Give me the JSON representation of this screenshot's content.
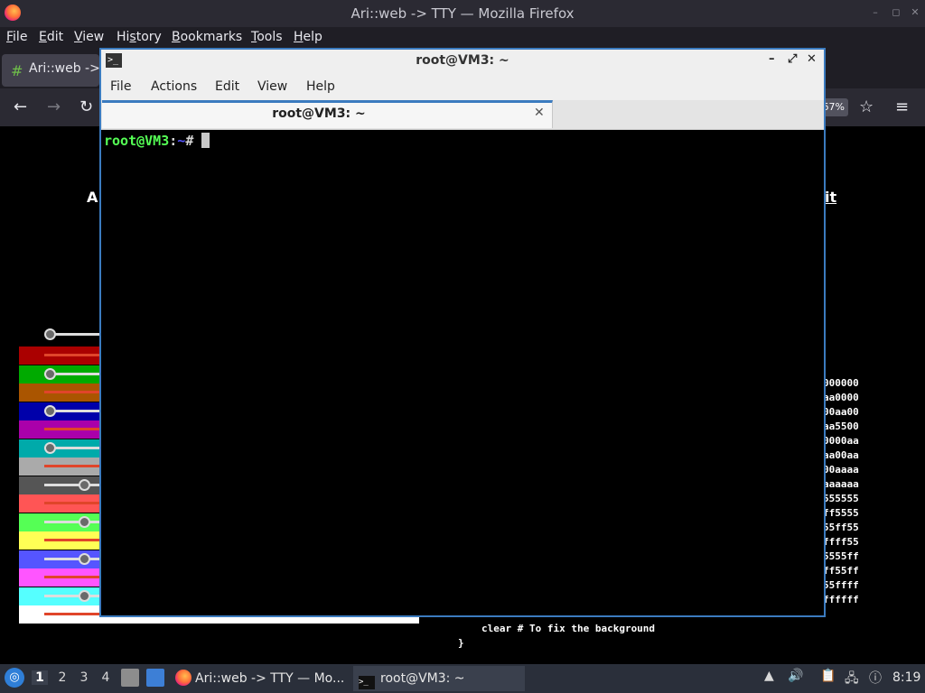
{
  "firefox": {
    "title": "Ari::web -> TTY — Mozilla Firefox",
    "menu": [
      "File",
      "Edit",
      "View",
      "History",
      "Bookmarks",
      "Tools",
      "Help"
    ],
    "menu_accel": [
      "F",
      "E",
      "V",
      "s",
      "B",
      "T",
      "H"
    ],
    "tab_label": "Ari::web ->",
    "zoom": "67%",
    "win_buttons": [
      "–",
      "◻",
      "✕"
    ]
  },
  "page": {
    "left_fragment": "A",
    "right_fragment": "it",
    "hex_values": [
      "000000",
      "aa0000",
      "00aa00",
      "aa5500",
      "0000aa",
      "aa00aa",
      "00aaaa",
      "aaaaaa",
      "555555",
      "ff5555",
      "55ff55",
      "ffff55",
      "5555ff",
      "ff55ff",
      "55ffff",
      "ffffff"
    ],
    "code_lines": [
      "clear # To fix the background",
      "}"
    ],
    "swatch_colors": [
      "#aa0000",
      "#00aa00",
      "#aa5500",
      "#0000aa",
      "#aa00aa",
      "#00aaaa",
      "#aaaaaa",
      "#555555",
      "#ff5555",
      "#55ff55",
      "#ffff55",
      "#5555ff",
      "#ff55ff",
      "#55ffff",
      "#ffffff"
    ]
  },
  "terminal": {
    "title": "root@VM3: ~",
    "menu": [
      "File",
      "Actions",
      "Edit",
      "View",
      "Help"
    ],
    "tab_label": "root@VM3: ~",
    "prompt_user": "root@VM3",
    "prompt_colon": ":",
    "prompt_path": "~",
    "prompt_symbol": "# "
  },
  "taskbar": {
    "workspaces": [
      "1",
      "2",
      "3",
      "4"
    ],
    "active_workspace": "1",
    "firefox_task": "Ari::web -> TTY — Mo...",
    "terminal_task": "root@VM3: ~",
    "clock": "8:19"
  }
}
